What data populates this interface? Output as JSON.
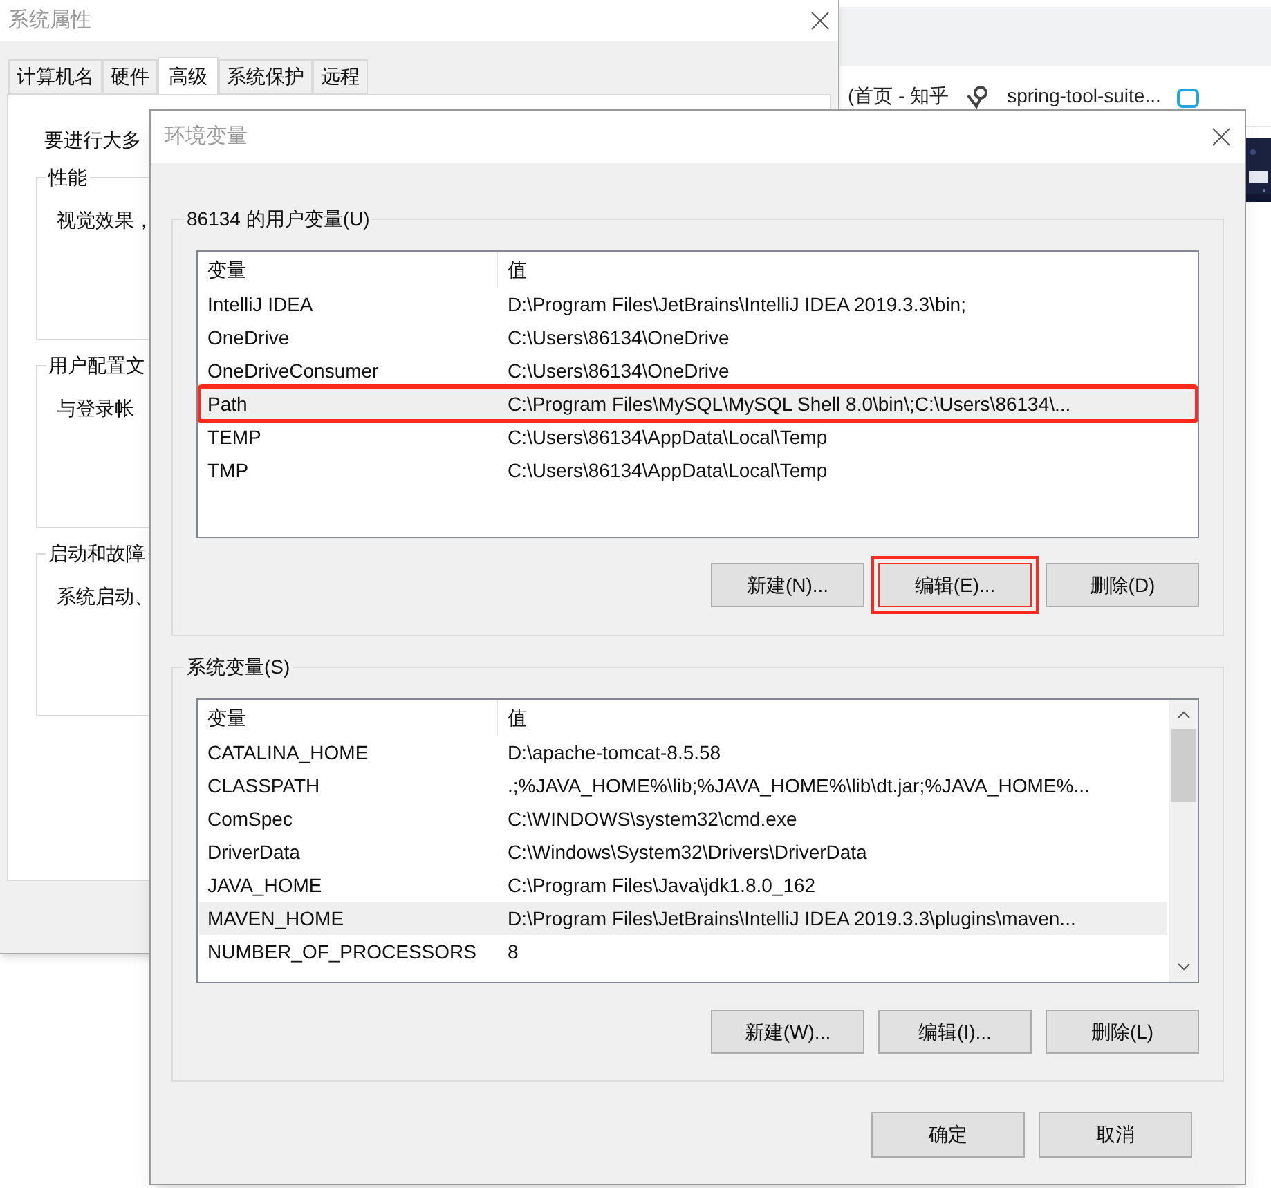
{
  "browser": {
    "bookmarks": [
      {
        "label": "(首页 - 知乎"
      },
      {
        "label": "spring-tool-suite..."
      }
    ]
  },
  "system_properties": {
    "title": "系统属性",
    "tabs": [
      {
        "label": "计算机名",
        "selected": false
      },
      {
        "label": "硬件",
        "selected": false
      },
      {
        "label": "高级",
        "selected": true
      },
      {
        "label": "系统保护",
        "selected": false
      },
      {
        "label": "远程",
        "selected": false
      }
    ],
    "intro": "要进行大多",
    "groups": [
      {
        "title": "性能",
        "text": "视觉效果，"
      },
      {
        "title": "用户配置文",
        "text": "与登录帐"
      },
      {
        "title": "启动和故障",
        "text": "系统启动、"
      }
    ]
  },
  "env_dialog": {
    "title": "环境变量",
    "user_vars": {
      "title": "86134 的用户变量(U)",
      "columns": [
        "变量",
        "值"
      ],
      "rows": [
        {
          "name": "IntelliJ IDEA",
          "value": "D:\\Program Files\\JetBrains\\IntelliJ IDEA 2019.3.3\\bin;",
          "selected": false,
          "highlighted": false
        },
        {
          "name": "OneDrive",
          "value": "C:\\Users\\86134\\OneDrive",
          "selected": false,
          "highlighted": false
        },
        {
          "name": "OneDriveConsumer",
          "value": "C:\\Users\\86134\\OneDrive",
          "selected": false,
          "highlighted": false
        },
        {
          "name": "Path",
          "value": "C:\\Program Files\\MySQL\\MySQL Shell 8.0\\bin\\;C:\\Users\\86134\\...",
          "selected": true,
          "highlighted": true
        },
        {
          "name": "TEMP",
          "value": "C:\\Users\\86134\\AppData\\Local\\Temp",
          "selected": false,
          "highlighted": false
        },
        {
          "name": "TMP",
          "value": "C:\\Users\\86134\\AppData\\Local\\Temp",
          "selected": false,
          "highlighted": false
        }
      ],
      "buttons": [
        {
          "label": "新建(N)...",
          "highlighted": false
        },
        {
          "label": "编辑(E)...",
          "highlighted": true
        },
        {
          "label": "删除(D)",
          "highlighted": false
        }
      ]
    },
    "system_vars": {
      "title": "系统变量(S)",
      "columns": [
        "变量",
        "值"
      ],
      "rows": [
        {
          "name": "CATALINA_HOME",
          "value": "D:\\apache-tomcat-8.5.58",
          "selected": false
        },
        {
          "name": "CLASSPATH",
          "value": ".;%JAVA_HOME%\\lib;%JAVA_HOME%\\lib\\dt.jar;%JAVA_HOME%...",
          "selected": false
        },
        {
          "name": "ComSpec",
          "value": "C:\\WINDOWS\\system32\\cmd.exe",
          "selected": false
        },
        {
          "name": "DriverData",
          "value": "C:\\Windows\\System32\\Drivers\\DriverData",
          "selected": false
        },
        {
          "name": "JAVA_HOME",
          "value": "C:\\Program Files\\Java\\jdk1.8.0_162",
          "selected": false
        },
        {
          "name": "MAVEN_HOME",
          "value": "D:\\Program Files\\JetBrains\\IntelliJ IDEA 2019.3.3\\plugins\\maven...",
          "selected": true
        },
        {
          "name": "NUMBER_OF_PROCESSORS",
          "value": "8",
          "selected": false
        }
      ],
      "buttons": [
        {
          "label": "新建(W)...",
          "highlighted": false
        },
        {
          "label": "编辑(I)...",
          "highlighted": false
        },
        {
          "label": "删除(L)",
          "highlighted": false
        }
      ]
    },
    "footer_buttons": [
      "确定",
      "取消"
    ]
  }
}
